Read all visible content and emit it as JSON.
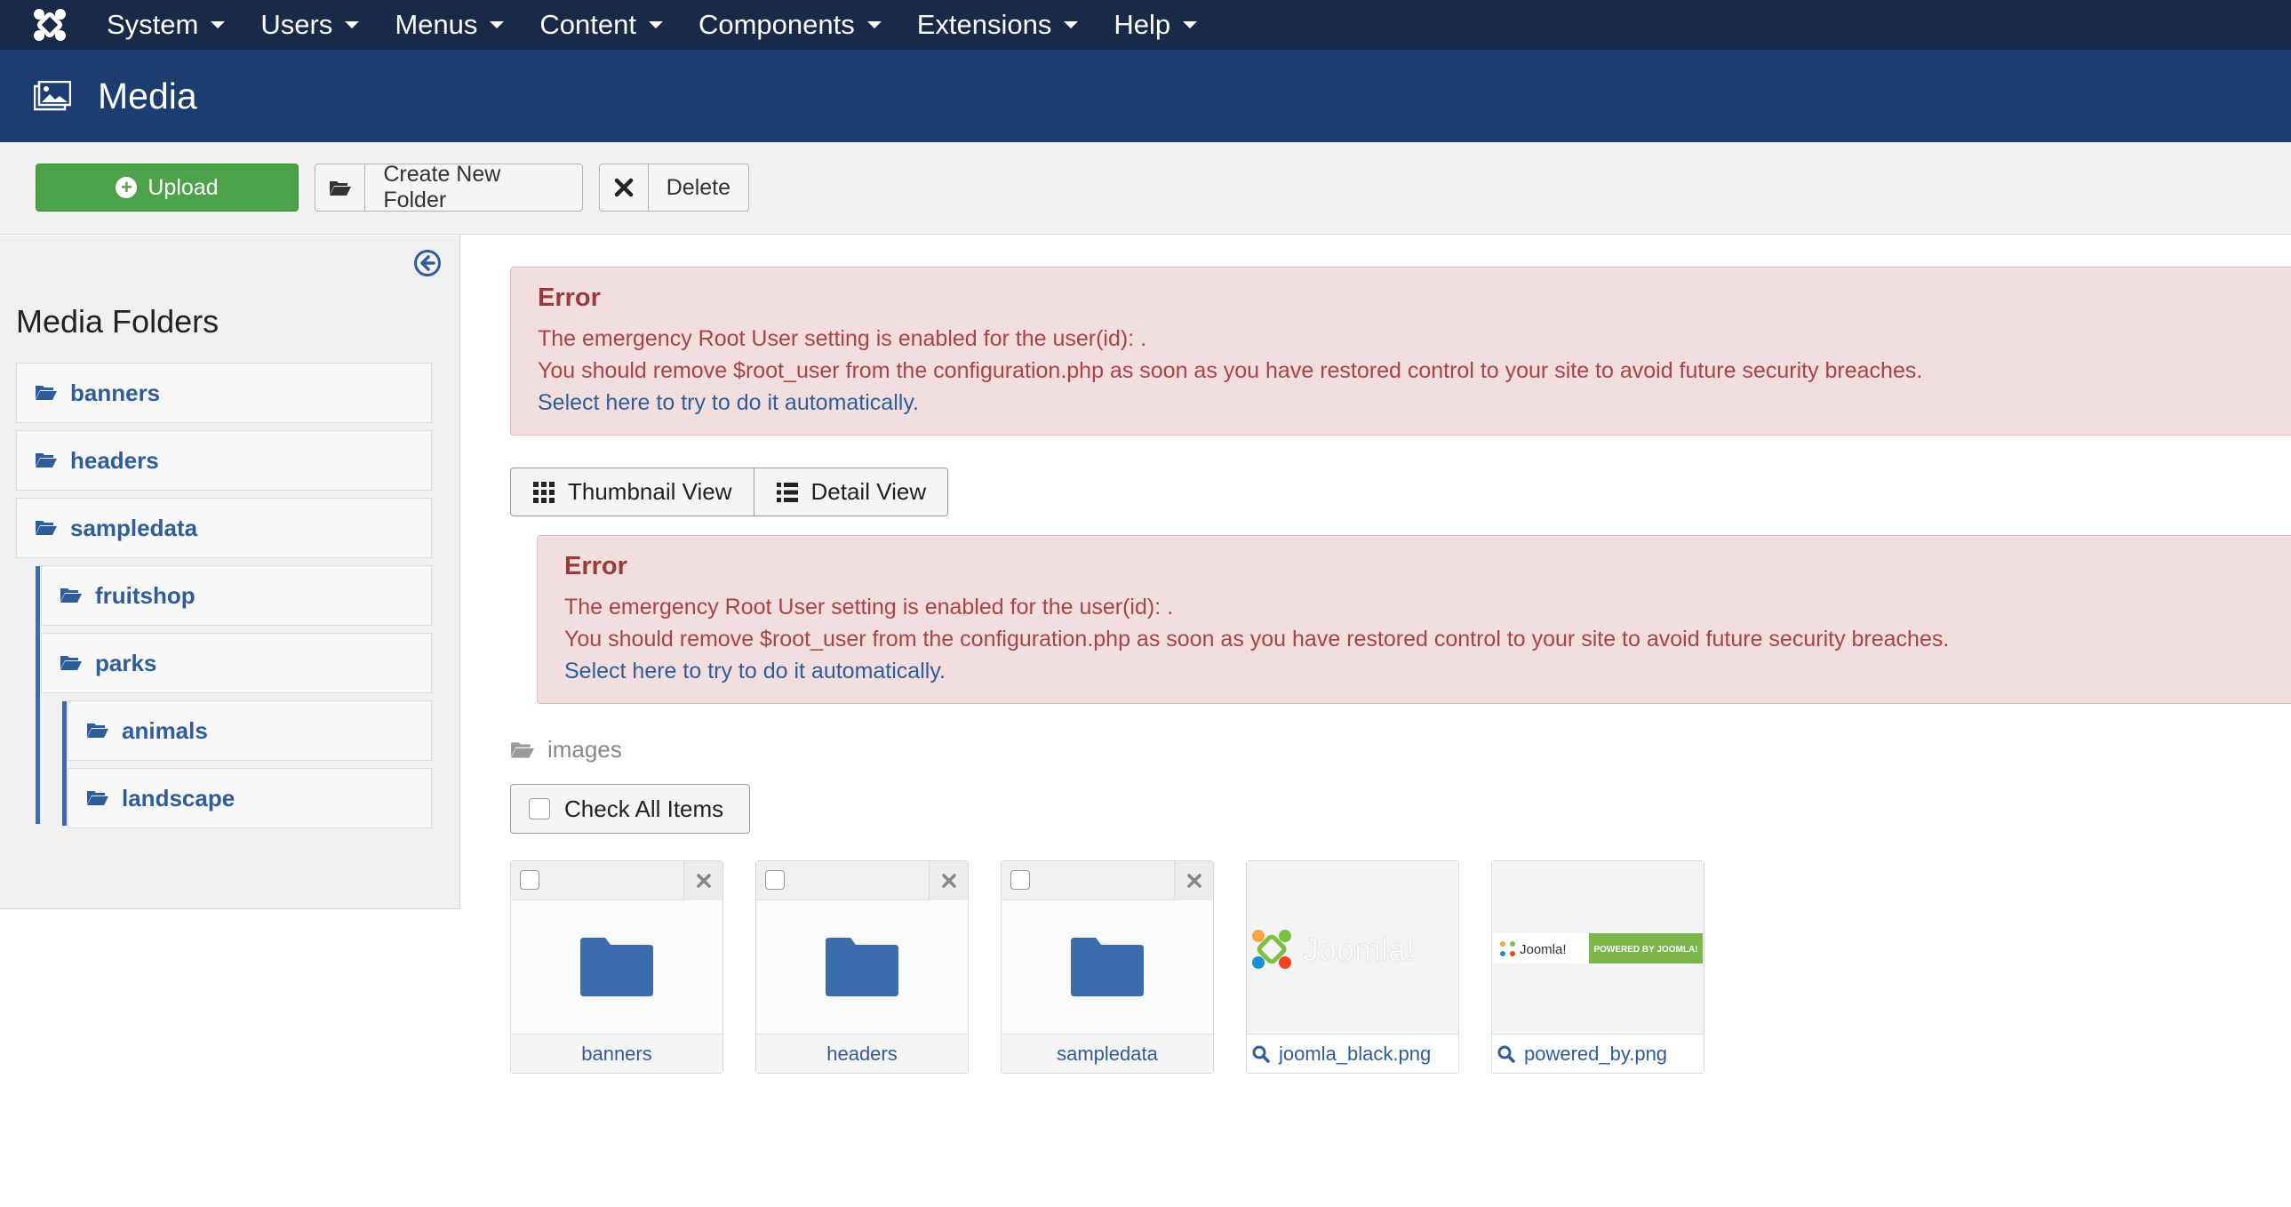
{
  "navbar": {
    "items": [
      {
        "label": "System"
      },
      {
        "label": "Users"
      },
      {
        "label": "Menus"
      },
      {
        "label": "Content"
      },
      {
        "label": "Components"
      },
      {
        "label": "Extensions"
      },
      {
        "label": "Help"
      }
    ]
  },
  "header": {
    "title": "Media"
  },
  "toolbar": {
    "upload_label": "Upload",
    "create_folder_label": "Create New Folder",
    "delete_label": "Delete"
  },
  "sidebar": {
    "title": "Media Folders",
    "folders": [
      {
        "label": "banners"
      },
      {
        "label": "headers"
      },
      {
        "label": "sampledata"
      },
      {
        "label": "fruitshop"
      },
      {
        "label": "parks"
      },
      {
        "label": "animals"
      },
      {
        "label": "landscape"
      }
    ]
  },
  "alerts": [
    {
      "heading": "Error",
      "line1": "The emergency Root User setting is enabled for the user(id): .",
      "line2": "You should remove $root_user from the configuration.php as soon as you have restored control to your site to avoid future security breaches.",
      "link": "Select here to try to do it automatically."
    },
    {
      "heading": "Error",
      "line1": "The emergency Root User setting is enabled for the user(id): .",
      "line2": "You should remove $root_user from the configuration.php as soon as you have restored control to your site to avoid future security breaches.",
      "link": "Select here to try to do it automatically."
    }
  ],
  "views": {
    "thumbnail_label": "Thumbnail View",
    "detail_label": "Detail View"
  },
  "breadcrumb": {
    "path": "images"
  },
  "check_all_label": "Check All Items",
  "items": [
    {
      "name": "banners",
      "type": "folder"
    },
    {
      "name": "headers",
      "type": "folder"
    },
    {
      "name": "sampledata",
      "type": "folder"
    },
    {
      "name": "joomla_black.png",
      "type": "image"
    },
    {
      "name": "powered_by.png",
      "type": "image"
    }
  ],
  "image_content": {
    "joomla_logo_text": "Joomla!",
    "powered_by_text": "POWERED BY JOOMLA!"
  },
  "colors": {
    "navbar": "#182a47",
    "header": "#1c3d6f",
    "upload_button": "#4ea34a",
    "link": "#2f5d99",
    "alert_bg": "#f2dede",
    "alert_text": "#a94442",
    "folder_icon": "#3a6bab"
  }
}
